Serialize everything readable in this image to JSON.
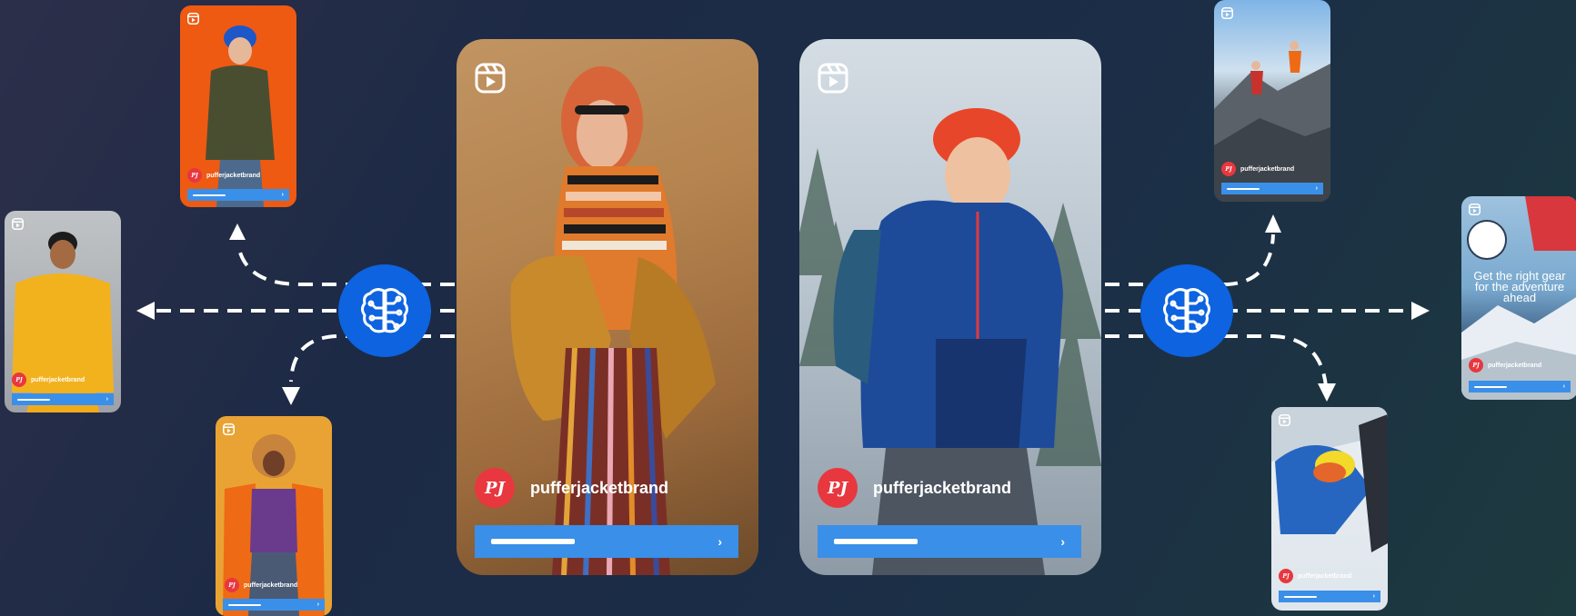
{
  "brand": {
    "handle": "pufferjacketbrand",
    "logo_initials": "PJ",
    "logo_color": "#e8373f",
    "cta_color": "#3a8fe8",
    "hub_color": "#0d63e0"
  },
  "icons": {
    "reel": "reels-icon",
    "hub": "ai-brain-circuit-icon",
    "cta": "chevron-right-icon"
  },
  "cards": {
    "left_main": {
      "handle": "pufferjacketbrand"
    },
    "right_main": {
      "handle": "pufferjacketbrand"
    },
    "top_left": {
      "handle": "pufferjacketbrand"
    },
    "left_mid": {
      "handle": "pufferjacketbrand"
    },
    "bottom_left": {
      "handle": "pufferjacketbrand"
    },
    "top_right": {
      "handle": "pufferjacketbrand"
    },
    "right_mid": {
      "handle": "pufferjacketbrand",
      "headline": "Get the right gear for the adventure ahead"
    },
    "bottom_right": {
      "handle": "pufferjacketbrand"
    }
  }
}
